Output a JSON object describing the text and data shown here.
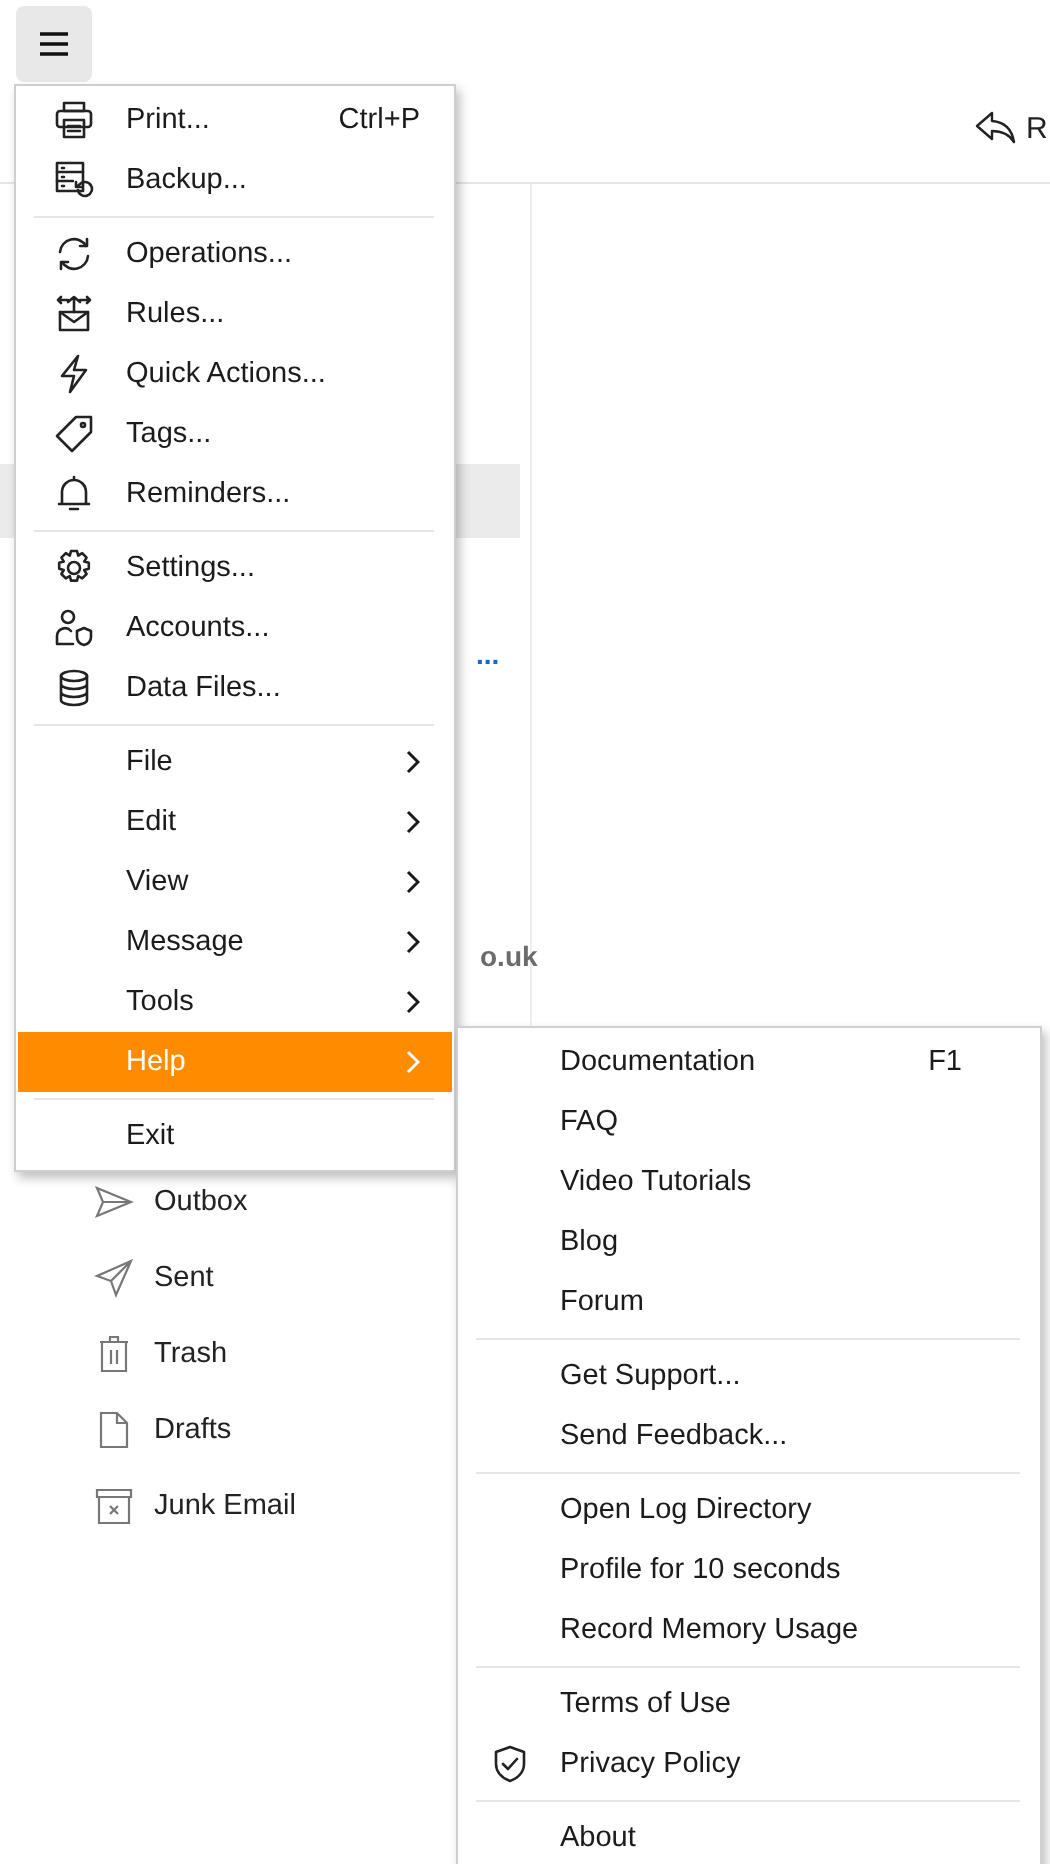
{
  "toolbar": {
    "menu_button": {
      "pressed": true
    },
    "reply_button": {
      "label": "R"
    }
  },
  "background": {
    "more_label": "...",
    "address_fragment": "o.uk",
    "folders": [
      {
        "label": "Outbox"
      },
      {
        "label": "Sent"
      },
      {
        "label": "Trash"
      },
      {
        "label": "Drafts"
      },
      {
        "label": "Junk Email"
      }
    ]
  },
  "main_menu": {
    "sections": [
      [
        {
          "kind": "command",
          "label": "Print...",
          "shortcut": "Ctrl+P"
        },
        {
          "kind": "command",
          "label": "Backup..."
        }
      ],
      [
        {
          "kind": "command",
          "label": "Operations..."
        },
        {
          "kind": "command",
          "label": "Rules..."
        },
        {
          "kind": "command",
          "label": "Quick Actions..."
        },
        {
          "kind": "command",
          "label": "Tags..."
        },
        {
          "kind": "command",
          "label": "Reminders..."
        }
      ],
      [
        {
          "kind": "command",
          "label": "Settings..."
        },
        {
          "kind": "command",
          "label": "Accounts..."
        },
        {
          "kind": "command",
          "label": "Data Files..."
        }
      ],
      [
        {
          "kind": "submenu",
          "label": "File",
          "selected": false
        },
        {
          "kind": "submenu",
          "label": "Edit",
          "selected": false
        },
        {
          "kind": "submenu",
          "label": "View",
          "selected": false
        },
        {
          "kind": "submenu",
          "label": "Message",
          "selected": false
        },
        {
          "kind": "submenu",
          "label": "Tools",
          "selected": false
        },
        {
          "kind": "submenu",
          "label": "Help",
          "selected": true
        }
      ],
      [
        {
          "kind": "command",
          "label": "Exit"
        }
      ]
    ]
  },
  "help_menu": {
    "sections": [
      [
        {
          "label": "Documentation",
          "shortcut": "F1"
        },
        {
          "label": "FAQ"
        },
        {
          "label": "Video Tutorials"
        },
        {
          "label": "Blog"
        },
        {
          "label": "Forum"
        }
      ],
      [
        {
          "label": "Get Support..."
        },
        {
          "label": "Send Feedback..."
        }
      ],
      [
        {
          "label": "Open Log Directory"
        },
        {
          "label": "Profile for 10 seconds"
        },
        {
          "label": "Record Memory Usage"
        }
      ],
      [
        {
          "label": "Terms of Use"
        },
        {
          "label": "Privacy Policy"
        }
      ],
      [
        {
          "label": "About"
        }
      ]
    ]
  }
}
